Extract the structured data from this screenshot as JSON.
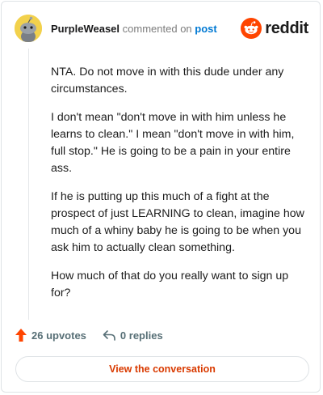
{
  "comment": {
    "username": "PurpleWeasel",
    "action_text": "commented on",
    "target_link": "post",
    "paragraphs": [
      "NTA. Do not move in with this dude under any circumstances.",
      "I don't mean \"don't move in with him unless he learns to clean.\" I mean \"don't move in with him, full stop.\" He is going to be a pain in your entire ass.",
      "If he is putting up this much of a fight at the prospect of just LEARNING to clean, imagine how much of a whiny baby he is going to be when you ask him to actually clean something.",
      "How much of that do you really want to sign up for?"
    ]
  },
  "brand": {
    "name": "reddit",
    "icon": "reddit-snoo-icon",
    "color": "#ff4500"
  },
  "avatar": {
    "icon": "snoo-avatar-icon",
    "color": "#f2d14c"
  },
  "stats": {
    "upvotes": "26 upvotes",
    "replies": "0 replies",
    "upvote_icon": "upvote-arrow-icon",
    "reply_icon": "reply-arrow-icon",
    "upvote_color": "#ff4500"
  },
  "cta": {
    "label": "View the conversation",
    "color": "#d93a00"
  }
}
